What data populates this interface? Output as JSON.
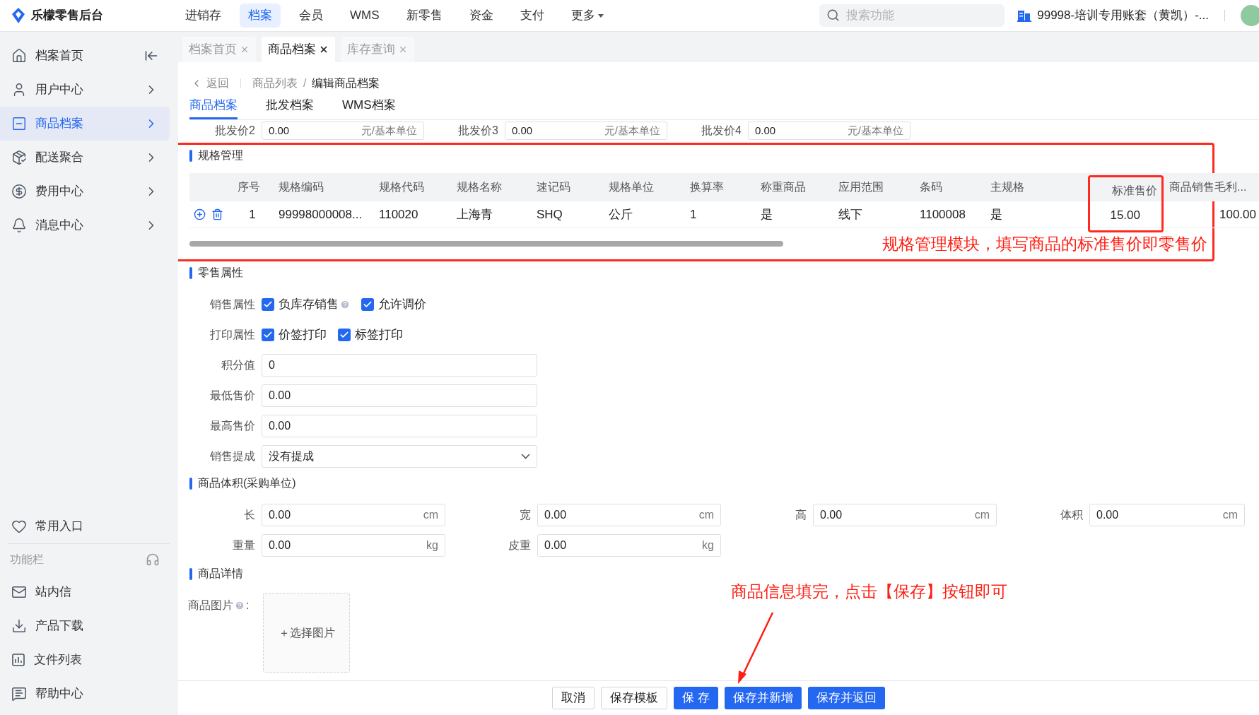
{
  "app": {
    "name": "乐檬零售后台"
  },
  "top_nav": [
    {
      "label": "进销存",
      "selected": false,
      "kind": "link"
    },
    {
      "label": "档案",
      "selected": true,
      "kind": "link"
    },
    {
      "label": "会员",
      "selected": false,
      "kind": "link"
    },
    {
      "label": "WMS",
      "selected": false,
      "kind": "link"
    },
    {
      "label": "新零售",
      "selected": false,
      "kind": "link"
    },
    {
      "label": "资金",
      "selected": false,
      "kind": "link"
    },
    {
      "label": "支付",
      "selected": false,
      "kind": "link"
    },
    {
      "label": "更多",
      "selected": false,
      "kind": "menu"
    }
  ],
  "search": {
    "placeholder": "搜索功能"
  },
  "account": "99998-培训专用账套（黄凯）-...",
  "sidebar": {
    "items": [
      {
        "label": "档案首页",
        "selected": false,
        "kind": "collapse"
      },
      {
        "label": "用户中心",
        "selected": false,
        "kind": "submenu"
      },
      {
        "label": "商品档案",
        "selected": true,
        "kind": "submenu"
      },
      {
        "label": "配送聚合",
        "selected": false,
        "kind": "submenu"
      },
      {
        "label": "费用中心",
        "selected": false,
        "kind": "submenu"
      },
      {
        "label": "消息中心",
        "selected": false,
        "kind": "submenu"
      }
    ],
    "favorites": "常用入口",
    "function_bar": {
      "title": "功能栏",
      "tools": [
        "站内信",
        "产品下载",
        "文件列表",
        "帮助中心"
      ]
    }
  },
  "page_tabs": [
    {
      "label": "档案首页",
      "selected": false
    },
    {
      "label": "商品档案",
      "selected": true
    },
    {
      "label": "库存查询",
      "selected": false
    }
  ],
  "breadcrumb": {
    "back": "返回",
    "separator": "/",
    "items": [
      "商品列表",
      "编辑商品档案"
    ]
  },
  "form_tabs": [
    {
      "label": "商品档案",
      "selected": true
    },
    {
      "label": "批发档案",
      "selected": false
    },
    {
      "label": "WMS档案",
      "selected": false
    }
  ],
  "wholesale_prices": [
    {
      "label": "批发价2",
      "value": "0.00",
      "unit": "元/基本单位"
    },
    {
      "label": "批发价3",
      "value": "0.00",
      "unit": "元/基本单位"
    },
    {
      "label": "批发价4",
      "value": "0.00",
      "unit": "元/基本单位"
    }
  ],
  "spec_section": {
    "title": "规格管理",
    "columns": [
      {
        "label": "序号",
        "annotated": false
      },
      {
        "label": "规格编码",
        "annotated": false
      },
      {
        "label": "规格代码",
        "annotated": false
      },
      {
        "label": "规格名称",
        "annotated": false
      },
      {
        "label": "速记码",
        "annotated": false
      },
      {
        "label": "规格单位",
        "annotated": false
      },
      {
        "label": "换算率",
        "annotated": false
      },
      {
        "label": "称重商品",
        "annotated": false
      },
      {
        "label": "应用范围",
        "annotated": false
      },
      {
        "label": "条码",
        "annotated": false
      },
      {
        "label": "主规格",
        "annotated": false
      },
      {
        "label": "标准售价",
        "annotated": true
      },
      {
        "label": "商品销售毛利...",
        "annotated": false
      }
    ],
    "rows": [
      {
        "cells": [
          "1",
          "99998000008...",
          "110020",
          "上海青",
          "SHQ",
          "公斤",
          "1",
          "是",
          "线下",
          "1100008",
          "是",
          "15.00",
          "100.00"
        ]
      }
    ],
    "annotation": "规格管理模块，填写商品的标准售价即零售价"
  },
  "retail_section": {
    "title": "零售属性",
    "check_rows": [
      {
        "label": "销售属性",
        "options": [
          {
            "label": "负库存销售",
            "checked": true,
            "help": true
          },
          {
            "label": "允许调价",
            "checked": true,
            "help": false
          }
        ]
      },
      {
        "label": "打印属性",
        "options": [
          {
            "label": "价签打印",
            "checked": true,
            "help": false
          },
          {
            "label": "标签打印",
            "checked": true,
            "help": false
          }
        ]
      }
    ],
    "fields": [
      {
        "label": "积分值",
        "value": "0",
        "kind": "input"
      },
      {
        "label": "最低售价",
        "value": "0.00",
        "kind": "input"
      },
      {
        "label": "最高售价",
        "value": "0.00",
        "kind": "input"
      },
      {
        "label": "销售提成",
        "value": "没有提成",
        "kind": "select"
      }
    ]
  },
  "volume_section": {
    "title": "商品体积(采购单位)",
    "rows": [
      [
        {
          "label": "长",
          "value": "0.00",
          "unit": "cm"
        },
        {
          "label": "宽",
          "value": "0.00",
          "unit": "cm"
        },
        {
          "label": "高",
          "value": "0.00",
          "unit": "cm"
        },
        {
          "label": "体积",
          "value": "0.00",
          "unit": "cm"
        }
      ],
      [
        {
          "label": "重量",
          "value": "0.00",
          "unit": "kg"
        },
        {
          "label": "皮重",
          "value": "0.00",
          "unit": "kg"
        }
      ]
    ]
  },
  "detail_section": {
    "title": "商品详情",
    "image_label": "商品图片",
    "colon": ":",
    "upload": "＋选择图片"
  },
  "annotation": "商品信息填完，点击【保存】按钮即可",
  "buttons": [
    {
      "label": "取消",
      "primary": false
    },
    {
      "label": "保存模板",
      "primary": false
    },
    {
      "label": "保 存",
      "primary": true
    },
    {
      "label": "保存并新增",
      "primary": true
    },
    {
      "label": "保存并返回",
      "primary": true
    }
  ]
}
